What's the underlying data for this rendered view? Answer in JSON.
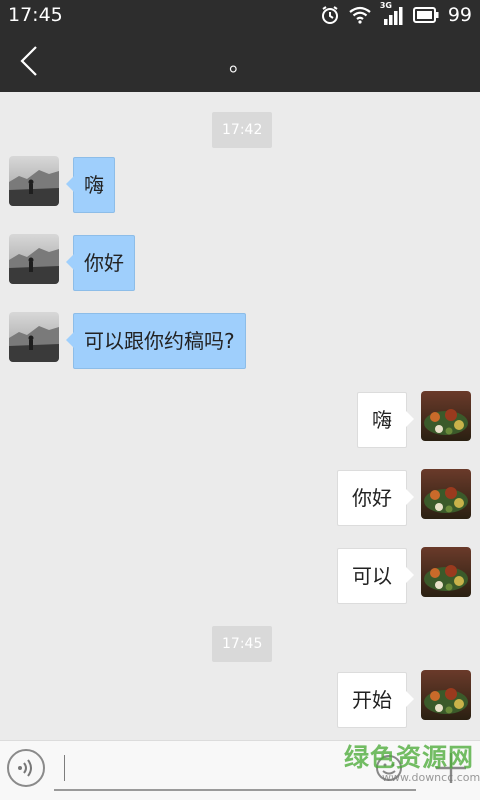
{
  "status_bar": {
    "time": "17:45",
    "icons": [
      "alarm-icon",
      "wifi-icon",
      "signal-3g-icon",
      "battery-icon"
    ],
    "network": "3G",
    "battery": "99"
  },
  "nav": {
    "title": "。",
    "back_icon": "chevron-left-icon"
  },
  "chat": {
    "timestamps": [
      "17:42",
      "17:45"
    ],
    "messages": [
      {
        "side": "left",
        "text": "嗨"
      },
      {
        "side": "left",
        "text": "你好"
      },
      {
        "side": "left",
        "text": "可以跟你约稿吗?"
      },
      {
        "side": "right",
        "text": "嗨"
      },
      {
        "side": "right",
        "text": "你好"
      },
      {
        "side": "right",
        "text": "可以"
      },
      {
        "side": "right",
        "text": "开始"
      }
    ]
  },
  "input_bar": {
    "value": "",
    "icons": [
      "voice-icon",
      "emoji-icon",
      "plus-icon"
    ]
  },
  "watermark": {
    "main": "绿色资源网",
    "sub": "www.downcc.com"
  },
  "colors": {
    "header": "#2d2d2d",
    "chat_background": "#ebebeb",
    "incoming_bubble": "#9fcffc",
    "outgoing_bubble": "#ffffff"
  }
}
